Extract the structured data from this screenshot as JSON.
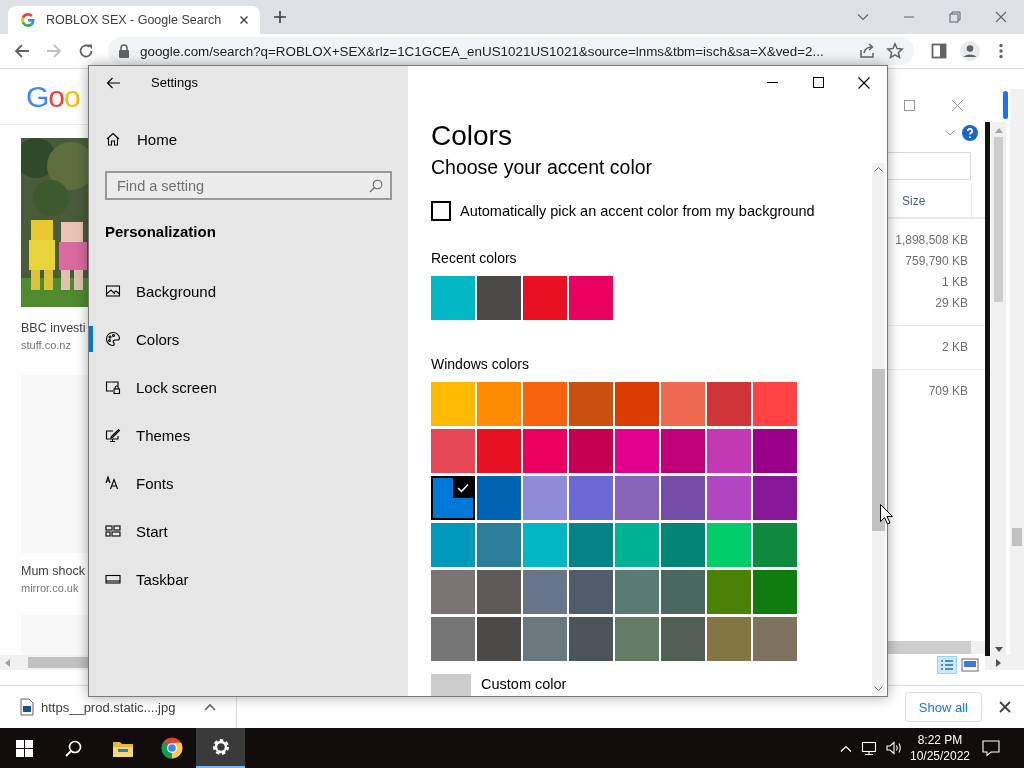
{
  "browser": {
    "tab": {
      "title": "ROBLOX SEX - Google Search"
    },
    "url": "google.com/search?q=ROBLOX+SEX&rlz=1C1GCEA_enUS1021US1021&source=lnms&tbm=isch&sa=X&ved=2...",
    "logo": "Goo",
    "results": [
      {
        "kind": "picture",
        "caption": "BBC investi",
        "source": "stuff.co.nz"
      },
      {
        "kind": "blank",
        "caption": "Mum shock",
        "source": "mirror.co.uk"
      },
      {
        "kind": "blank"
      }
    ],
    "download": {
      "filename": "https__prod.static....jpg"
    },
    "show_all": "Show all"
  },
  "explorer": {
    "column": "Size",
    "groups": [
      {
        "sizes": [
          "1,898,508 KB",
          "759,790 KB",
          "1 KB",
          "29 KB"
        ]
      },
      {
        "sizes": [
          "2 KB"
        ]
      },
      {
        "sizes": [
          "709 KB"
        ]
      }
    ]
  },
  "settings": {
    "title": "Settings",
    "home": "Home",
    "search_placeholder": "Find a setting",
    "section": "Personalization",
    "nav": [
      {
        "label": "Background",
        "kind": "picture",
        "selected": false
      },
      {
        "label": "Colors",
        "kind": "palette",
        "selected": true
      },
      {
        "label": "Lock screen",
        "kind": "lockscreen",
        "selected": false
      },
      {
        "label": "Themes",
        "kind": "themes",
        "selected": false
      },
      {
        "label": "Fonts",
        "kind": "fonts",
        "selected": false
      },
      {
        "label": "Start",
        "kind": "start",
        "selected": false
      },
      {
        "label": "Taskbar",
        "kind": "taskbar",
        "selected": false
      }
    ],
    "heading": "Colors",
    "subheading": "Choose your accent color",
    "auto_pick": {
      "label": "Automatically pick an accent color from my background",
      "checked": false
    },
    "recent_label": "Recent colors",
    "recent_colors": [
      {
        "color": "#00b7c3"
      },
      {
        "color": "#4c4a48"
      },
      {
        "color": "#e81123"
      },
      {
        "color": "#ea005e"
      }
    ],
    "windows_label": "Windows colors",
    "windows_colors": [
      {
        "color": "#ffb900",
        "selected": false
      },
      {
        "color": "#ff8c00",
        "selected": false
      },
      {
        "color": "#f7630c",
        "selected": false
      },
      {
        "color": "#ca5010",
        "selected": false
      },
      {
        "color": "#da3b01",
        "selected": false
      },
      {
        "color": "#ef6950",
        "selected": false
      },
      {
        "color": "#d13438",
        "selected": false
      },
      {
        "color": "#ff4343",
        "selected": false
      },
      {
        "color": "#e74856",
        "selected": false
      },
      {
        "color": "#e81123",
        "selected": false
      },
      {
        "color": "#ea005e",
        "selected": false
      },
      {
        "color": "#c30052",
        "selected": false
      },
      {
        "color": "#e3008c",
        "selected": false
      },
      {
        "color": "#bf0077",
        "selected": false
      },
      {
        "color": "#c239b3",
        "selected": false
      },
      {
        "color": "#9a0089",
        "selected": false
      },
      {
        "color": "#0078d7",
        "selected": true
      },
      {
        "color": "#0063b1",
        "selected": false
      },
      {
        "color": "#8e8cd8",
        "selected": false
      },
      {
        "color": "#6b69d6",
        "selected": false
      },
      {
        "color": "#8764b8",
        "selected": false
      },
      {
        "color": "#744da9",
        "selected": false
      },
      {
        "color": "#b146c2",
        "selected": false
      },
      {
        "color": "#881798",
        "selected": false
      },
      {
        "color": "#0099bc",
        "selected": false
      },
      {
        "color": "#2d7d9a",
        "selected": false
      },
      {
        "color": "#00b7c3",
        "selected": false
      },
      {
        "color": "#038387",
        "selected": false
      },
      {
        "color": "#00b294",
        "selected": false
      },
      {
        "color": "#018574",
        "selected": false
      },
      {
        "color": "#00cc6a",
        "selected": false
      },
      {
        "color": "#10893e",
        "selected": false
      },
      {
        "color": "#7a7574",
        "selected": false
      },
      {
        "color": "#5d5a58",
        "selected": false
      },
      {
        "color": "#68768a",
        "selected": false
      },
      {
        "color": "#515c6b",
        "selected": false
      },
      {
        "color": "#567c73",
        "selected": false
      },
      {
        "color": "#486860",
        "selected": false
      },
      {
        "color": "#498205",
        "selected": false
      },
      {
        "color": "#107c10",
        "selected": false
      },
      {
        "color": "#767676",
        "selected": false
      },
      {
        "color": "#4c4a48",
        "selected": false
      },
      {
        "color": "#69797e",
        "selected": false
      },
      {
        "color": "#4a5459",
        "selected": false
      },
      {
        "color": "#647c64",
        "selected": false
      },
      {
        "color": "#525e54",
        "selected": false
      },
      {
        "color": "#847545",
        "selected": false
      },
      {
        "color": "#7e735f",
        "selected": false
      }
    ],
    "custom_color": "Custom color"
  },
  "taskbar": {
    "apps": [
      {
        "kind": "start",
        "selected": false
      },
      {
        "kind": "search",
        "selected": false
      },
      {
        "kind": "folder",
        "selected": false
      },
      {
        "kind": "chrome",
        "selected": false
      },
      {
        "kind": "settings",
        "selected": true
      }
    ],
    "time": "8:22 PM",
    "date": "10/25/2022"
  }
}
